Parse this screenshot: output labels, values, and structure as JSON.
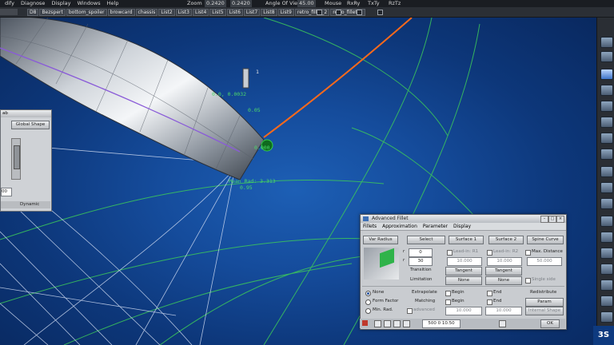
{
  "menubar": {
    "items": [
      "dify",
      "Diagnose",
      "Display",
      "Windows",
      "Help"
    ],
    "zoom_label": "Zoom",
    "zoom_value": "0.2420",
    "zoom_value2": "0.2420",
    "angle_label": "Angle Of View",
    "angle_value": "45.00",
    "r1": "Mouse",
    "r2": "RxRy",
    "r3": "TxTy",
    "r4": "RzTz"
  },
  "shelf_tabs": [
    "D8",
    "Bezspert",
    "bottom_spoiler",
    "browcard",
    "chassis",
    "List2",
    "List3",
    "List4",
    "List5",
    "List6",
    "List7",
    "List8",
    "List9",
    "retro_fillet_2",
    "retro_fillet_1"
  ],
  "viewport": {
    "readout1": "0.0, 0.0032",
    "readout2": "0.05",
    "readout3": "0.000",
    "readout4": "Mean Rad: 3.313",
    "readout5": "0.95",
    "label_1": "1"
  },
  "left_panel": {
    "title": "ab",
    "dropdown": "Global Shape",
    "value": "00",
    "dynamic": "Dynamic"
  },
  "dialog": {
    "title": "Advanced Fillet",
    "tabs": [
      "Fillets",
      "Approximation",
      "Parameter",
      "Display"
    ],
    "var_radius": "Var Radius",
    "select": "Select",
    "surface1": "Surface 1",
    "surface2": "Surface 2",
    "spine": "Spine Curve",
    "r1_val": "0",
    "r2_val": "30",
    "lead1": "Lead-in: R1",
    "lead2": "Lead-in: R2",
    "maxdist": "Max. Distance",
    "n1": "10.000",
    "n2": "10.000",
    "n3": "10.000",
    "n4": "50.000",
    "transition_label": "Transition",
    "transition1": "Tangent",
    "transition2": "Tangent",
    "limitation_label": "Limitation",
    "limitation1": "None",
    "limitation2": "None",
    "single_side": "Single side",
    "radio": [
      "None",
      "Form Factor",
      "Min. Rad."
    ],
    "extrapolate_label": "Extrapolate",
    "begin": "Begin",
    "end": "End",
    "redistribute": "Redistribute",
    "matching_label": "Matching",
    "begin2": "Begin",
    "end2": "End",
    "param": "Param",
    "advanced": "advanced",
    "e1": "10.000",
    "e2": "10.000",
    "internal_shape": "Internal Shape",
    "status": "500 0 10.50",
    "ok": "OK"
  },
  "colors": {
    "accent_orange": "#ff6a1a",
    "guide_green": "#3cc85a",
    "bg_blue": "#154c9c"
  }
}
